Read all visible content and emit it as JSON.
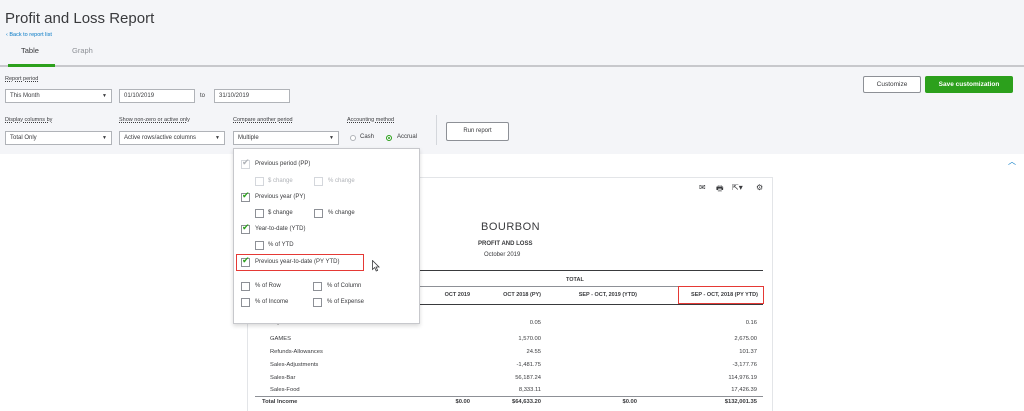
{
  "header": {
    "title": "Profit and Loss Report",
    "back_link": "Back to report list",
    "tabs": [
      "Table",
      "Graph"
    ]
  },
  "controls": {
    "report_period_label": "Report period",
    "report_period_value": "This Month",
    "date_from": "01/10/2019",
    "to_label": "to",
    "date_to": "31/10/2019",
    "display_columns_label": "Display columns by",
    "display_columns_value": "Total Only",
    "show_nonzero_label": "Show non-zero or active only",
    "show_nonzero_value": "Active rows/active columns",
    "compare_label": "Compare another period",
    "compare_value": "Multiple",
    "accounting_label": "Accounting method",
    "accounting_options": [
      "Cash",
      "Accrual"
    ],
    "accounting_selected": "Accrual",
    "run_report": "Run report",
    "customize": "Customize",
    "save_customization": "Save customization"
  },
  "compare_dropdown": {
    "options": [
      {
        "label": "Previous period (PP)",
        "checked": true,
        "disabled": true
      },
      {
        "label": "$ change",
        "checked": false,
        "disabled": true
      },
      {
        "label": "% change",
        "checked": false,
        "disabled": true
      },
      {
        "label": "Previous year (PY)",
        "checked": true,
        "disabled": false
      },
      {
        "label": "$ change",
        "checked": false,
        "disabled": false
      },
      {
        "label": "% change",
        "checked": false,
        "disabled": false
      },
      {
        "label": "Year-to-date (YTD)",
        "checked": true,
        "disabled": false
      },
      {
        "label": "% of YTD",
        "checked": false,
        "disabled": false
      },
      {
        "label": "Previous year-to-date (PY YTD)",
        "checked": true,
        "disabled": false
      },
      {
        "label": "% of Row",
        "checked": false,
        "disabled": false
      },
      {
        "label": "% of Column",
        "checked": false,
        "disabled": false
      },
      {
        "label": "% of Income",
        "checked": false,
        "disabled": false
      },
      {
        "label": "% of Expense",
        "checked": false,
        "disabled": false
      }
    ]
  },
  "report": {
    "company": "BOURBON",
    "title": "PROFIT AND LOSS",
    "period": "October 2019",
    "total_header": "TOTAL",
    "columns": [
      "OCT 2019",
      "OCT 2018 (PY)",
      "SEP - OCT, 2019 (YTD)",
      "SEP - OCT, 2018 (PY YTD)"
    ],
    "rows": [
      {
        "label": "Deposit Interest",
        "values": [
          "",
          "0.05",
          "",
          "0.16"
        ]
      },
      {
        "label": "GAMES",
        "values": [
          "",
          "1,570.00",
          "",
          "2,675.00"
        ]
      },
      {
        "label": "Refunds-Allowances",
        "values": [
          "",
          "24.55",
          "",
          "101.37"
        ]
      },
      {
        "label": "Sales-Adjustments",
        "values": [
          "",
          "-1,481.75",
          "",
          "-3,177.76"
        ]
      },
      {
        "label": "Sales-Bar",
        "values": [
          "",
          "56,187.24",
          "",
          "114,976.19"
        ]
      },
      {
        "label": "Sales-Food",
        "values": [
          "",
          "8,333.11",
          "",
          "17,426.39"
        ]
      }
    ],
    "total_row": {
      "label": "Total Income",
      "values": [
        "$0.00",
        "$64,633.20",
        "$0.00",
        "$132,001.35"
      ]
    }
  }
}
